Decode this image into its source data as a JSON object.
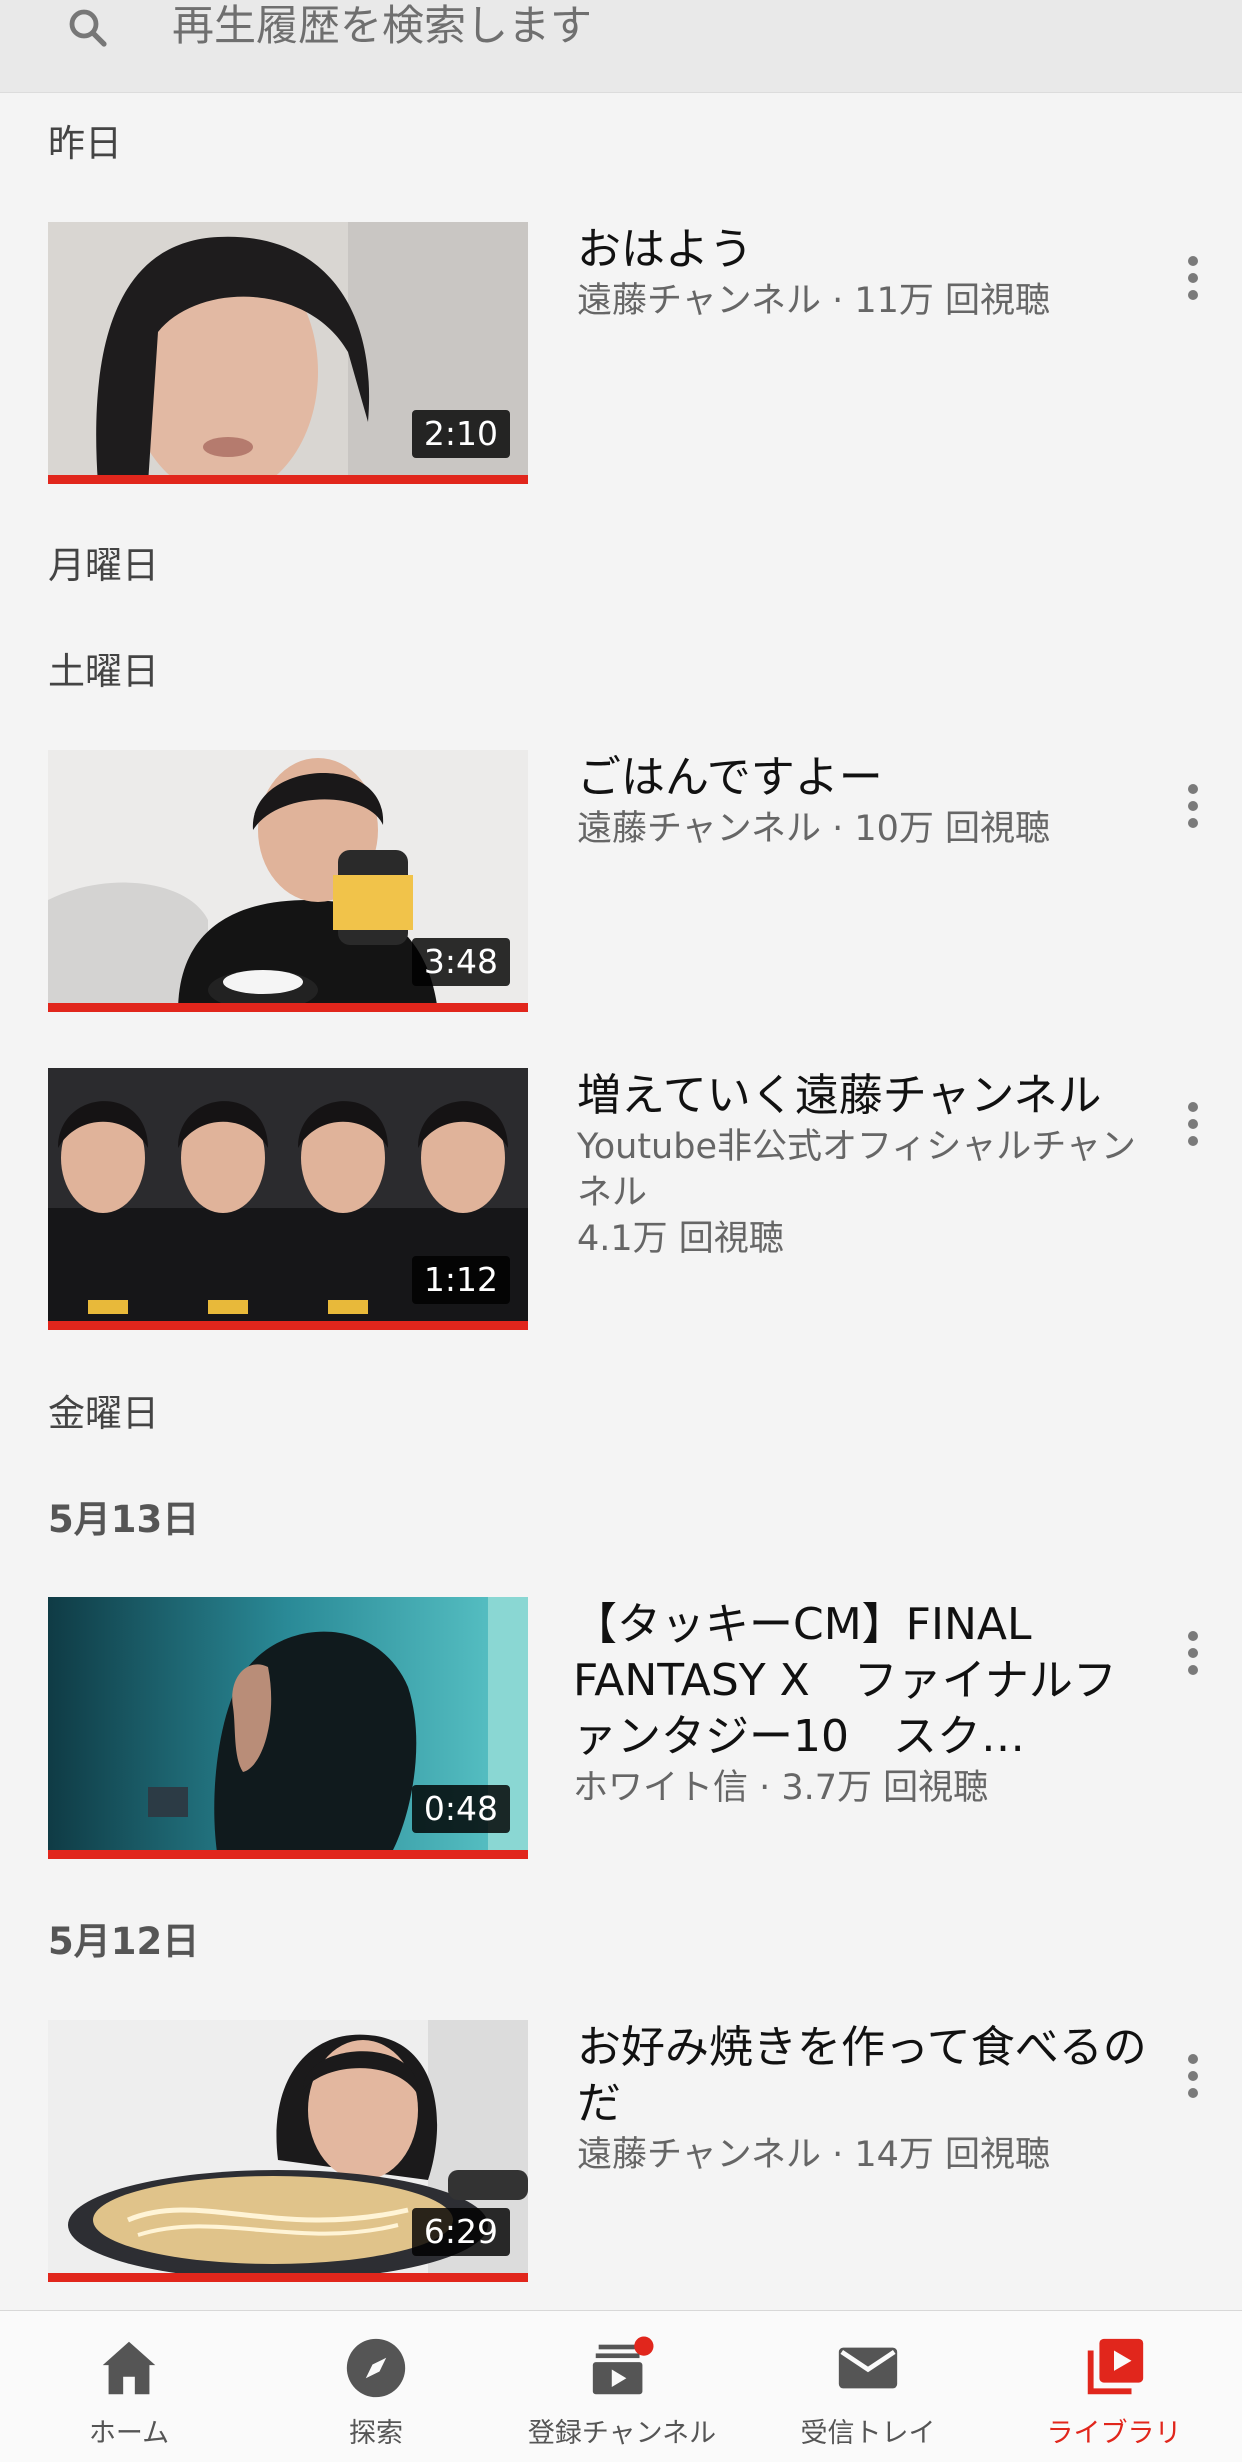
{
  "search": {
    "placeholder": "再生履歴を検索します"
  },
  "sections": [
    {
      "title": "昨日"
    },
    {
      "title": "月曜日"
    },
    {
      "title": "土曜日"
    },
    {
      "title": "金曜日"
    },
    {
      "title": "5月13日"
    },
    {
      "title": "5月12日"
    }
  ],
  "videos": [
    {
      "title": "おはよう",
      "channel": "遠藤チャンネル · 11万 回視聴",
      "channel2": "",
      "views": "",
      "duration": "2:10",
      "watched_fraction": 1.0
    },
    {
      "title": "ごはんですよー",
      "channel": "遠藤チャンネル · 10万 回視聴",
      "channel2": "",
      "views": "",
      "duration": "3:48",
      "watched_fraction": 1.0
    },
    {
      "title": "増えていく遠藤チャンネル",
      "channel": "Youtube非公式オフィシャルチャンネル",
      "channel2": "",
      "views": "4.1万 回視聴",
      "duration": "1:12",
      "watched_fraction": 1.0
    },
    {
      "title": "【タッキーCM】FINAL FANTASY X　ファイナルファンタジー10　スク…",
      "channel": "ホワイト信 · 3.7万 回視聴",
      "channel2": "",
      "views": "",
      "duration": "0:48",
      "watched_fraction": 1.0
    },
    {
      "title": "お好み焼きを作って食べるのだ",
      "channel": "遠藤チャンネル · 14万 回視聴",
      "channel2": "",
      "views": "",
      "duration": "6:29",
      "watched_fraction": 1.0
    }
  ],
  "nav": [
    {
      "label": "ホーム",
      "icon": "home-icon",
      "active": false
    },
    {
      "label": "探索",
      "icon": "compass-icon",
      "active": false
    },
    {
      "label": "登録チャンネル",
      "icon": "subscriptions-icon",
      "active": false,
      "badge": true
    },
    {
      "label": "受信トレイ",
      "icon": "mail-icon",
      "active": false
    },
    {
      "label": "ライブラリ",
      "icon": "library-icon",
      "active": true
    }
  ],
  "colors": {
    "accent": "#e1261c",
    "background": "#f4f4f4"
  }
}
